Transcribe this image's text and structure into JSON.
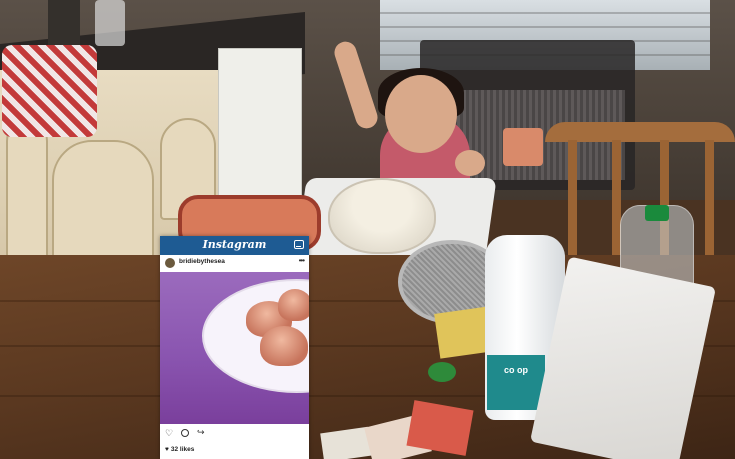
{
  "instagram": {
    "app_name": "Instagram",
    "username": "bridiebythesea",
    "more_glyph": "•••",
    "likes": "32 likes",
    "icons": [
      "inbox-icon",
      "heart-icon",
      "comment-icon",
      "share-icon"
    ],
    "header_color": "#1e5b93"
  },
  "scene": {
    "milk_brand": "co op"
  }
}
